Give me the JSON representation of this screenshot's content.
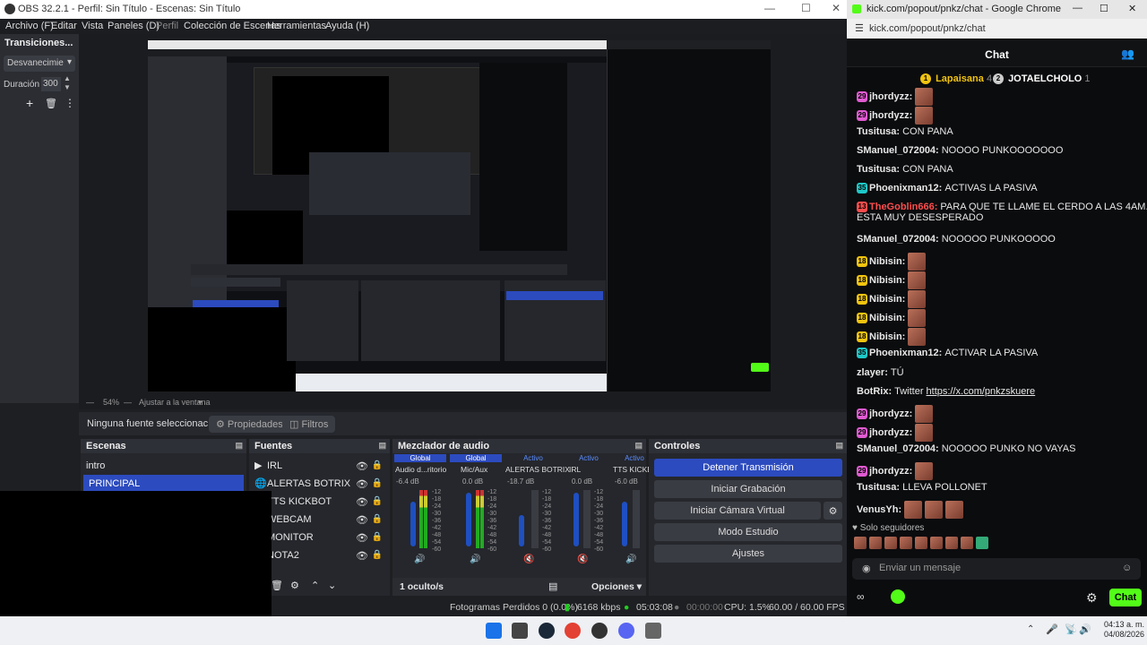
{
  "obs": {
    "title": "OBS 32.2.1 - Perfil: Sin Título - Escenas: Sin Título",
    "menu": [
      "Archivo (F)",
      "Editar",
      "Vista",
      "Paneles (D)",
      "Perfil",
      "Colección de Escenas",
      "Herramientas",
      "Ayuda (H)"
    ],
    "transitions": {
      "title": "Transiciones...",
      "type": "Desvanecimie",
      "duration_label": "Duración",
      "duration_value": "300"
    },
    "zoom": "54%",
    "zoom_option": "Ajustar a la ventana",
    "source_bar": {
      "none_selected": "Ninguna fuente seleccionac",
      "properties": "Propiedades",
      "filters": "Filtros"
    },
    "scenes": {
      "title": "Escenas",
      "items": [
        "intro",
        "PRINCIPAL"
      ]
    },
    "sources": {
      "title": "Fuentes",
      "items": [
        "IRL",
        "ALERTAS BOTRIX",
        "TTS KICKBOT",
        "WEBCAM",
        "MONITOR",
        "NOTA2"
      ]
    },
    "mixer": {
      "title": "Mezclador de audio",
      "channels": [
        {
          "tag": "Global",
          "name": "Audio d...ritorio",
          "db": "-6.4 dB"
        },
        {
          "tag": "Global",
          "name": "Mic/Aux",
          "db": "0.0 dB"
        },
        {
          "tag": "Activo",
          "name": "ALERTAS BOTRIX",
          "db": "-18.7 dB"
        },
        {
          "tag": "Activo",
          "name": "IRL",
          "db": "0.0 dB"
        },
        {
          "tag": "Activo",
          "name": "TTS KICKBOT",
          "db": "-6.0 dB"
        }
      ],
      "scale": [
        "-12",
        "-18",
        "-24",
        "-30",
        "-36",
        "-42",
        "-48",
        "-54",
        "-60"
      ],
      "hidden": "1 oculto/s",
      "options": "Opciones"
    },
    "controls": {
      "title": "Controles",
      "stop_stream": "Detener Transmisión",
      "start_rec": "Iniciar Grabación",
      "start_vcam": "Iniciar Cámara Virtual",
      "studio": "Modo Estudio",
      "settings": "Ajustes"
    },
    "status": {
      "dropped": "Fotogramas Perdidos 0 (0.0%)",
      "kbps": "6168 kbps",
      "stream_time": "05:03:08",
      "rec_time": "00:00:00",
      "cpu": "CPU: 1.5%",
      "fps": "60.00 / 60.00 FPS"
    }
  },
  "chrome": {
    "title": "kick.com/popout/pnkz/chat - Google Chrome",
    "url": "kick.com/popout/pnkz/chat",
    "chat_title": "Chat",
    "leaderboard": [
      {
        "rank": "1",
        "name": "Lapaisana",
        "count": "4"
      },
      {
        "rank": "2",
        "name": "JOTAELCHOLO",
        "count": "1"
      }
    ],
    "messages": [
      {
        "badge": "29",
        "user": "jhordyzz:",
        "text": "",
        "color": "#e8e8e8",
        "emotes": 1
      },
      {
        "badge": "29",
        "user": "jhordyzz:",
        "text": "",
        "color": "#e8e8e8",
        "emotes": 1
      },
      {
        "badge": "",
        "user": "Tusitusa:",
        "text": "CON PANA",
        "color": "#e8e8e8",
        "emotes": 0
      },
      {
        "badge": "",
        "user": "SManuel_072004:",
        "text": "NOOOO PUNKOOOOOOO",
        "color": "#e8e8e8",
        "emotes": 0
      },
      {
        "badge": "",
        "user": "Tusitusa:",
        "text": "CON PANA",
        "color": "#e8e8e8",
        "emotes": 0
      },
      {
        "badge": "35",
        "user": "Phoenixman12:",
        "text": "ACTIVAS LA PASIVA",
        "color": "#e8e8e8",
        "emotes": 0
      },
      {
        "badge": "13",
        "user": "TheGoblin666:",
        "text": "PARA QUE TE LLAME EL CERDO A LAS 4AM.",
        "text2": "ESTA MUY DESESPERADO",
        "color": "#ff4d4d",
        "emotes": 0
      },
      {
        "badge": "",
        "user": "SManuel_072004:",
        "text": "NOOOOO PUNKOOOOO",
        "color": "#e8e8e8",
        "emotes": 0
      },
      {
        "badge": "18",
        "user": "Nibisin:",
        "text": "",
        "color": "#e8e8e8",
        "emotes": 1
      },
      {
        "badge": "18",
        "user": "Nibisin:",
        "text": "",
        "color": "#e8e8e8",
        "emotes": 1
      },
      {
        "badge": "18",
        "user": "Nibisin:",
        "text": "",
        "color": "#e8e8e8",
        "emotes": 1
      },
      {
        "badge": "18",
        "user": "Nibisin:",
        "text": "",
        "color": "#e8e8e8",
        "emotes": 1
      },
      {
        "badge": "18",
        "user": "Nibisin:",
        "text": "",
        "color": "#e8e8e8",
        "emotes": 1
      },
      {
        "badge": "35",
        "user": "Phoenixman12:",
        "text": "ACTIVAR LA PASIVA",
        "color": "#e8e8e8",
        "emotes": 0
      },
      {
        "badge": "",
        "user": "zlayer:",
        "text": "TÚ",
        "color": "#e8e8e8",
        "emotes": 0
      },
      {
        "badge": "",
        "user": "BotRix:",
        "text": "Twitter",
        "link": "https://x.com/pnkzskuere",
        "color": "#e8e8e8",
        "emotes": 0
      },
      {
        "badge": "29",
        "user": "jhordyzz:",
        "text": "",
        "color": "#e8e8e8",
        "emotes": 1
      },
      {
        "badge": "29",
        "user": "jhordyzz:",
        "text": "",
        "color": "#e8e8e8",
        "emotes": 1
      },
      {
        "badge": "",
        "user": "SManuel_072004:",
        "text": "NOOOOO PUNKO NO VAYAS",
        "color": "#e8e8e8",
        "emotes": 0
      },
      {
        "badge": "29",
        "user": "jhordyzz:",
        "text": "",
        "color": "#e8e8e8",
        "emotes": 1
      },
      {
        "badge": "",
        "user": "Tusitusa:",
        "text": "LLEVA POLLONET",
        "color": "#e8e8e8",
        "emotes": 0
      },
      {
        "badge": "",
        "user": "VenusYh:",
        "text": "",
        "color": "#e8e8e8",
        "emotes": 3
      }
    ],
    "followers_only": "Solo seguidores",
    "input_placeholder": "Enviar un mensaje",
    "send_label": "Chat"
  },
  "taskbar": {
    "time": "04:13 a. m.",
    "date": "04/08/2026"
  },
  "colors": {
    "kick_green": "#53fc18",
    "obs_blue": "#2c4bbf"
  }
}
